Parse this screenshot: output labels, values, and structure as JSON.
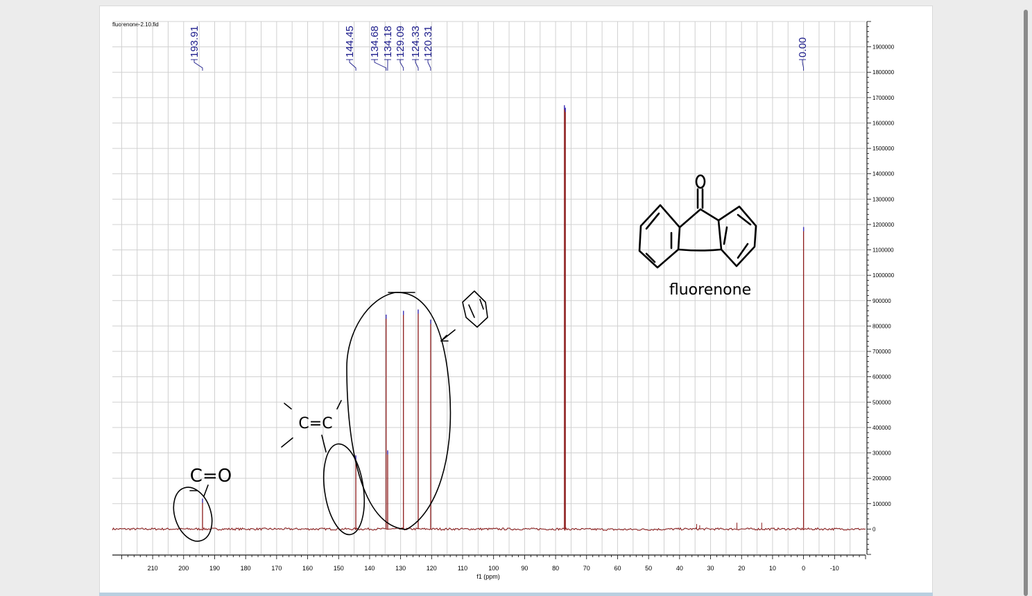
{
  "document": {
    "filename": "fluorenone-2.10.fid"
  },
  "chart_data": {
    "type": "line",
    "xlabel": "f1 (ppm)",
    "ylabel": "",
    "xlim": [
      223,
      -20
    ],
    "ylim": [
      -100000,
      2000000
    ],
    "x_ticks": [
      210,
      200,
      190,
      180,
      170,
      160,
      150,
      140,
      130,
      120,
      110,
      100,
      90,
      80,
      70,
      60,
      50,
      40,
      30,
      20,
      10,
      0,
      -10
    ],
    "y_ticks": [
      0,
      100000,
      200000,
      300000,
      400000,
      500000,
      600000,
      700000,
      800000,
      900000,
      1000000,
      1100000,
      1200000,
      1300000,
      1400000,
      1500000,
      1600000,
      1700000,
      1800000,
      1900000
    ],
    "grid": true,
    "peaks": [
      {
        "ppm": 193.91,
        "height": 120000
      },
      {
        "ppm": 144.45,
        "height": 290000
      },
      {
        "ppm": 134.68,
        "height": 845000
      },
      {
        "ppm": 134.18,
        "height": 310000
      },
      {
        "ppm": 129.09,
        "height": 860000
      },
      {
        "ppm": 124.33,
        "height": 865000
      },
      {
        "ppm": 120.31,
        "height": 825000
      },
      {
        "ppm": 77.16,
        "height": 1670000
      },
      {
        "ppm": 76.84,
        "height": 1660000
      },
      {
        "ppm": 0.0,
        "height": 1190000
      }
    ],
    "minor_peaks": [
      {
        "ppm": 34.5,
        "height": 20000
      },
      {
        "ppm": 33.5,
        "height": 15000
      },
      {
        "ppm": 21.5,
        "height": 25000
      },
      {
        "ppm": 13.5,
        "height": 25000
      }
    ],
    "peak_labels": [
      "193.91",
      "144.45",
      "134.68",
      "134.18",
      "129.09",
      "124.33",
      "120.31",
      "0.00"
    ],
    "colors": {
      "spectrum": "#8b1a1a",
      "peak_label": "#1a1a8a",
      "peak_tip": "#3a3acc",
      "grid": "#d0d0d0",
      "ink": "#000000"
    }
  },
  "annotations": {
    "carbonyl_label": "C=O",
    "alkene_label": "C=C",
    "structure_caption": "fluorenone",
    "carbonyl_oxygen": "O"
  }
}
